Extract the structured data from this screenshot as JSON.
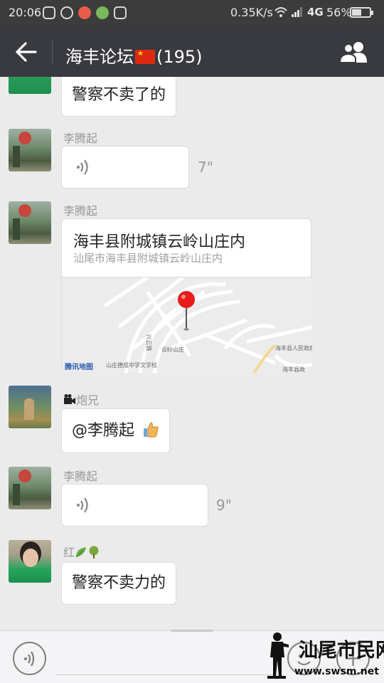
{
  "status_bar": {
    "time": "20:06",
    "speed": "0.35K/s",
    "network": "4G",
    "battery_percent_text": "56%",
    "battery_level": 0.56
  },
  "header": {
    "title": "海丰论坛",
    "count": "(195)",
    "flag_icon": "china-flag-icon"
  },
  "messages": [
    {
      "type": "text",
      "text": "警察不卖了的",
      "avatar": "avatar-partial"
    },
    {
      "type": "voice",
      "sender": "李腾起",
      "duration": "7\""
    },
    {
      "type": "location",
      "sender": "李腾起",
      "title": "海丰县附城镇云岭山庄内",
      "subtitle": "汕尾市海丰县附城镇云岭山庄内",
      "map_labels": [
        "兴云路",
        "云岭山庄",
        "海丰县人民政府",
        "山庄德成中学文学校",
        "海丰县政"
      ],
      "map_brand": "腾讯地图"
    },
    {
      "type": "text",
      "sender": "炮兄",
      "text": "@李腾起"
    },
    {
      "type": "voice",
      "sender": "李腾起",
      "duration": "9\""
    },
    {
      "type": "text",
      "sender": "红",
      "text": "警察不卖力的"
    }
  ],
  "watermark": {
    "text": "汕尾市民网",
    "url": "www.swsm.net"
  },
  "colors": {
    "status_bar": "#3c3c3c",
    "title_bar": "#393a3f",
    "chat_bg": "#ebebeb",
    "map_pin": "#e81c1c"
  }
}
